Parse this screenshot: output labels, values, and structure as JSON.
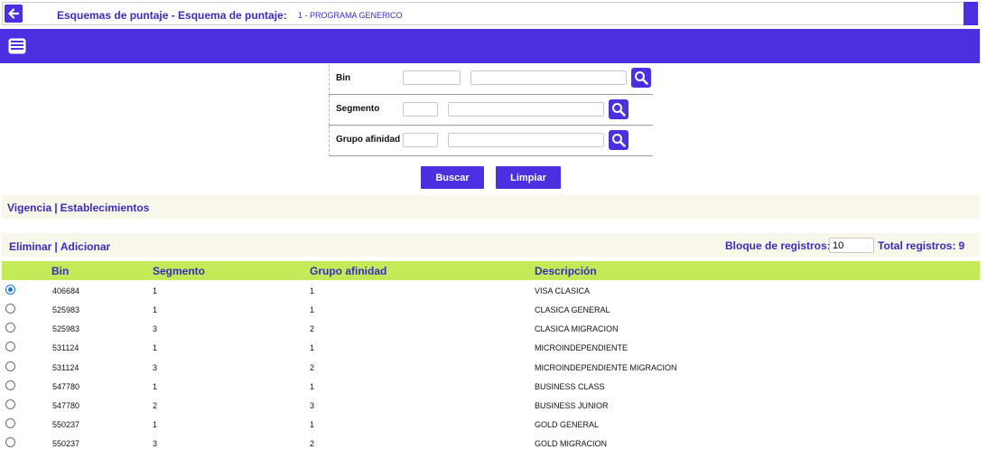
{
  "header": {
    "title": "Esquemas de puntaje - Esquema de puntaje:",
    "subtitle": "1 - PROGRAMA GENERICO",
    "back_icon": "arrow-left-icon",
    "band_icon": "form-card-icon"
  },
  "filters": {
    "bin_label": "Bin",
    "segmento_label": "Segmento",
    "grupo_label": "Grupo afinidad",
    "search_icon": "search-icon"
  },
  "actions": {
    "buscar": "Buscar",
    "limpiar": "Limpiar"
  },
  "links": {
    "vigencia": "Vigencia",
    "sep": "|",
    "establecimientos": "Establecimientos",
    "eliminar": "Eliminar",
    "adicionar": "Adicionar"
  },
  "paging": {
    "bloque_label": "Bloque de registros:",
    "bloque_value": "10",
    "total_label": "Total registros:",
    "total_value": "9"
  },
  "table": {
    "columns": [
      "Bin",
      "Segmento",
      "Grupo afinidad",
      "Descripción"
    ],
    "rows": [
      {
        "bin": "406684",
        "segmento": "1",
        "grupo": "1",
        "descripcion": "VISA CLASICA",
        "selected": true
      },
      {
        "bin": "525983",
        "segmento": "1",
        "grupo": "1",
        "descripcion": "CLASICA GENERAL",
        "selected": false
      },
      {
        "bin": "525983",
        "segmento": "3",
        "grupo": "2",
        "descripcion": "CLASICA MIGRACION",
        "selected": false
      },
      {
        "bin": "531124",
        "segmento": "1",
        "grupo": "1",
        "descripcion": "MICROINDEPENDIENTE",
        "selected": false
      },
      {
        "bin": "531124",
        "segmento": "3",
        "grupo": "2",
        "descripcion": "MICROINDEPENDIENTE MIGRACION",
        "selected": false
      },
      {
        "bin": "547780",
        "segmento": "1",
        "grupo": "1",
        "descripcion": "BUSINESS CLASS",
        "selected": false
      },
      {
        "bin": "547780",
        "segmento": "2",
        "grupo": "3",
        "descripcion": "BUSINESS JUNIOR",
        "selected": false
      },
      {
        "bin": "550237",
        "segmento": "1",
        "grupo": "1",
        "descripcion": "GOLD GENERAL",
        "selected": false
      },
      {
        "bin": "550237",
        "segmento": "3",
        "grupo": "2",
        "descripcion": "GOLD MIGRACION",
        "selected": false
      }
    ]
  },
  "colors": {
    "accent": "#4b2fe0",
    "link": "#3a2bbd",
    "table_header": "#c5ea57",
    "bar_bg": "#f7f8e9"
  }
}
